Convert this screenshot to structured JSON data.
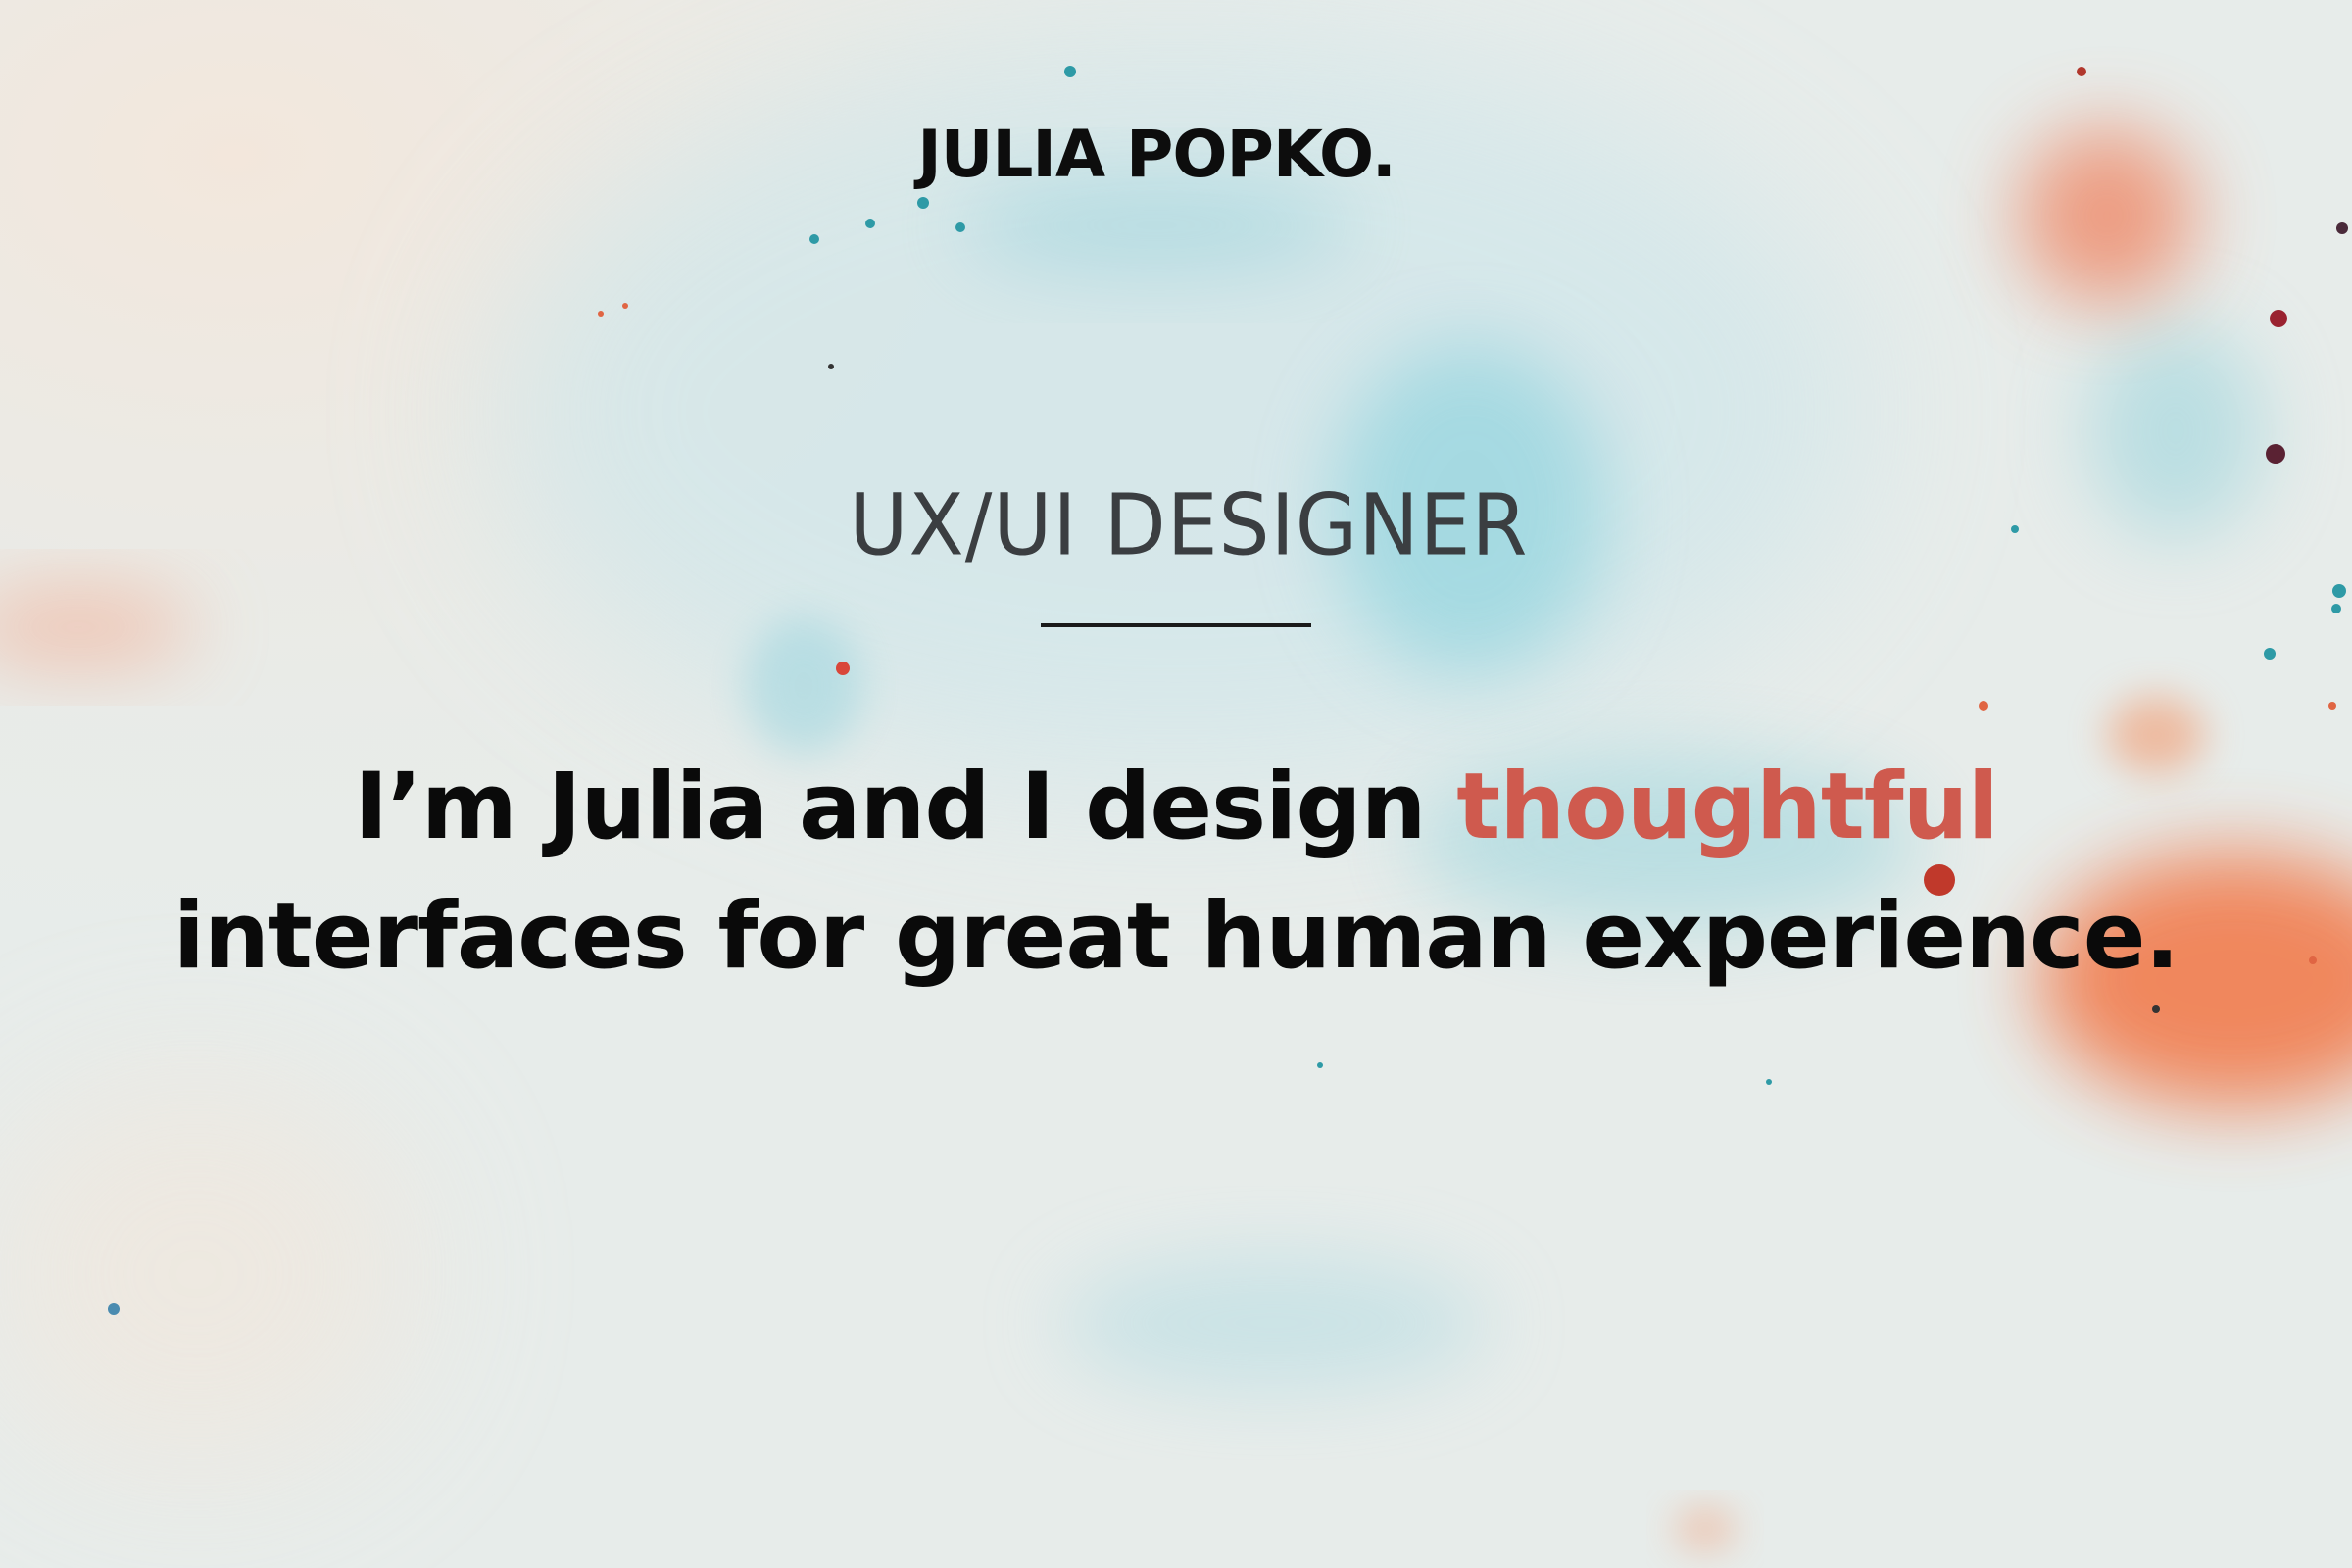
{
  "header": {
    "logo_text": "JULIA POPKO."
  },
  "hero": {
    "role": "UX/UI DESIGNER",
    "tagline_part1": "I’m Julia and I design ",
    "tagline_highlight": "thoughtful",
    "tagline_part2": "interfaces for great human experience."
  },
  "colors": {
    "accent": "#cf5a4e",
    "text": "#0a0a0a",
    "subtitle": "#3b3e41",
    "background": "#e7ecea",
    "splash_blue": "#6fc4d2",
    "splash_orange": "#f0784e"
  },
  "background": {
    "description_icon": "watercolor-marble-background"
  }
}
